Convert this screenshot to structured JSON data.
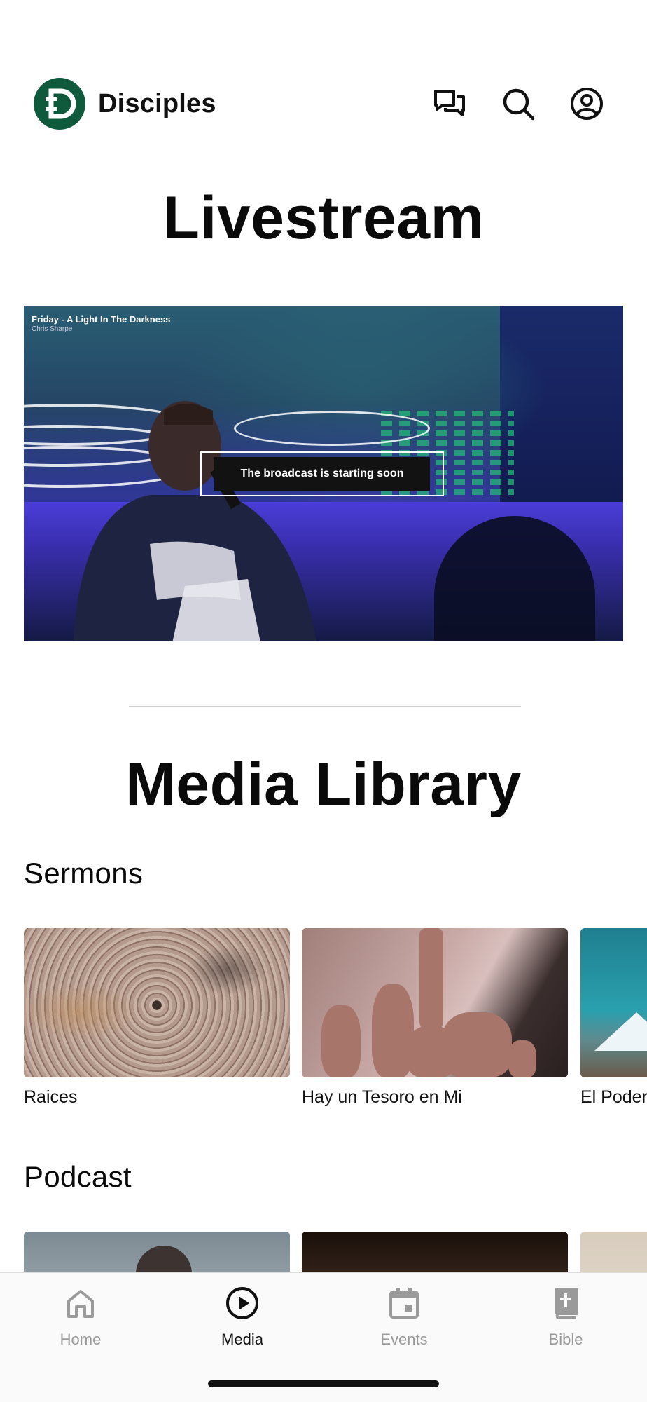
{
  "app": {
    "name": "Disciples",
    "logo_letter": "D"
  },
  "header": {
    "icons": [
      "chat-bubbles-icon",
      "search-icon",
      "account-icon"
    ]
  },
  "livestream": {
    "heading": "Livestream",
    "video": {
      "title": "Friday - A Light In The Darkness",
      "speaker": "Chris Sharpe",
      "overlay_message": "The broadcast is starting soon"
    }
  },
  "media_library": {
    "heading": "Media Library",
    "sections": [
      {
        "title": "Sermons",
        "items": [
          {
            "label": "Raices"
          },
          {
            "label": "Hay un Tesoro en Mi"
          },
          {
            "label": "El Poder"
          }
        ]
      },
      {
        "title": "Podcast",
        "items": [
          {
            "label": ""
          },
          {
            "label": ""
          },
          {
            "label": ""
          }
        ]
      }
    ]
  },
  "tabbar": {
    "tabs": [
      {
        "label": "Home",
        "icon": "home-icon",
        "active": false
      },
      {
        "label": "Media",
        "icon": "play-circle-icon",
        "active": true
      },
      {
        "label": "Events",
        "icon": "calendar-icon",
        "active": false
      },
      {
        "label": "Bible",
        "icon": "bible-icon",
        "active": false
      }
    ]
  },
  "colors": {
    "brand_green": "#0f5a3c",
    "active_tab": "#111111",
    "inactive_tab": "#9a9a9a"
  }
}
